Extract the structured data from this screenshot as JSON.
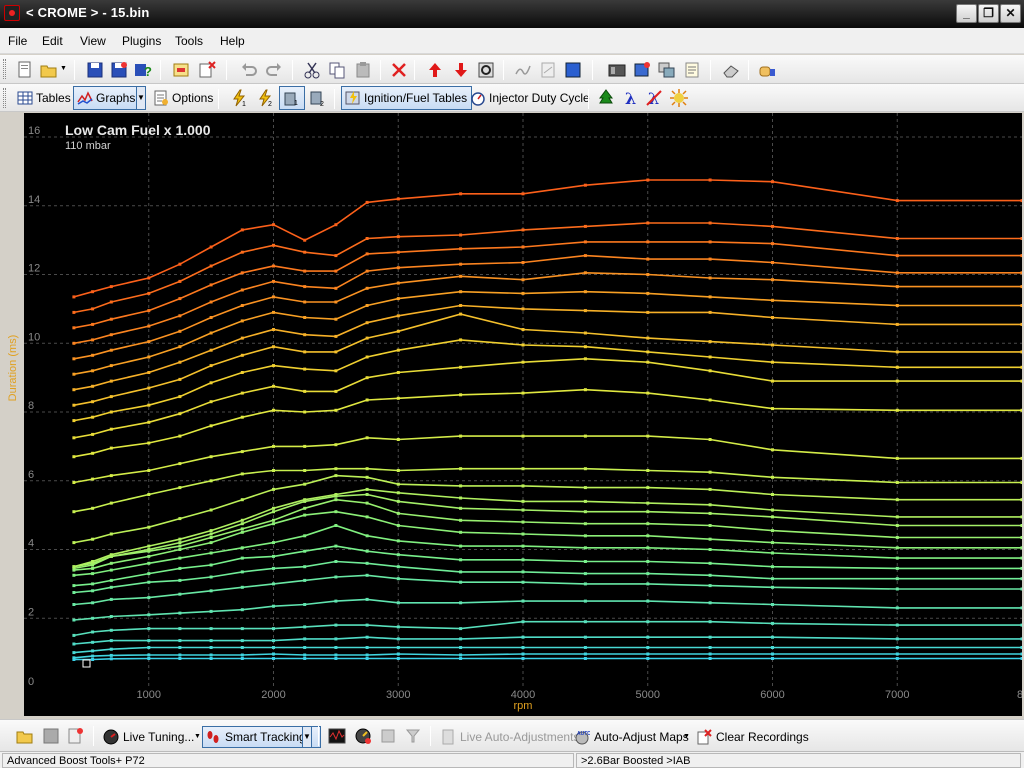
{
  "window": {
    "title": "< CROME > - 15.bin"
  },
  "menu": [
    "File",
    "Edit",
    "View",
    "Plugins",
    "Tools",
    "Help"
  ],
  "toolbar2": {
    "tables": "Tables",
    "graphs": "Graphs",
    "options": "Options",
    "ignition_fuel_tables": "Ignition/Fuel Tables",
    "injector_duty_cycle": "Injector Duty Cycle"
  },
  "graph": {
    "title": "Low Cam Fuel x 1.000",
    "subtitle": "110 mbar",
    "ylabel": "Duration (ms)",
    "xlabel": "rpm"
  },
  "chart_data": {
    "type": "line",
    "title": "Low Cam Fuel x 1.000",
    "subtitle": "110 mbar",
    "xlabel": "rpm",
    "ylabel": "Duration (ms)",
    "xlim": [
      0,
      8000
    ],
    "ylim": [
      0,
      16.7
    ],
    "x_ticks": [
      "1000",
      "2000",
      "3000",
      "4000",
      "5000",
      "6000",
      "7000",
      "8"
    ],
    "y_ticks": [
      "0",
      "2",
      "4",
      "6",
      "8",
      "10",
      "12",
      "14",
      "16"
    ],
    "grid": true,
    "x": [
      400,
      550,
      700,
      1000,
      1250,
      1500,
      1750,
      2000,
      2250,
      2500,
      2750,
      3000,
      3500,
      4000,
      4500,
      5000,
      5500,
      6000,
      7000,
      8000
    ],
    "series": [
      {
        "values": [
          0.8,
          0.8,
          0.82,
          0.83,
          0.83,
          0.83,
          0.83,
          0.83,
          0.83,
          0.83,
          0.83,
          0.83,
          0.83,
          0.83,
          0.83,
          0.83,
          0.83,
          0.83,
          0.83,
          0.83
        ],
        "color": "#3ad0e8"
      },
      {
        "values": [
          0.85,
          0.9,
          0.92,
          0.93,
          0.93,
          0.93,
          0.93,
          0.96,
          0.93,
          0.93,
          0.93,
          0.96,
          0.93,
          0.96,
          0.96,
          0.96,
          0.96,
          0.96,
          0.96,
          0.96
        ],
        "color": "#40d4e0"
      },
      {
        "values": [
          1.0,
          1.05,
          1.1,
          1.15,
          1.15,
          1.15,
          1.15,
          1.15,
          1.15,
          1.15,
          1.15,
          1.15,
          1.15,
          1.15,
          1.15,
          1.15,
          1.15,
          1.15,
          1.15,
          1.15
        ],
        "color": "#48d8d4"
      },
      {
        "values": [
          1.25,
          1.3,
          1.35,
          1.35,
          1.35,
          1.35,
          1.35,
          1.35,
          1.4,
          1.4,
          1.45,
          1.4,
          1.4,
          1.45,
          1.45,
          1.45,
          1.45,
          1.45,
          1.4,
          1.4
        ],
        "color": "#50dcc8"
      },
      {
        "values": [
          1.5,
          1.6,
          1.65,
          1.7,
          1.7,
          1.7,
          1.7,
          1.7,
          1.75,
          1.8,
          1.8,
          1.75,
          1.7,
          1.9,
          1.9,
          1.9,
          1.9,
          1.85,
          1.8,
          1.8
        ],
        "color": "#58e0bc"
      },
      {
        "values": [
          1.95,
          2.0,
          2.05,
          2.1,
          2.15,
          2.2,
          2.25,
          2.35,
          2.4,
          2.5,
          2.55,
          2.45,
          2.45,
          2.5,
          2.5,
          2.5,
          2.45,
          2.4,
          2.3,
          2.3
        ],
        "color": "#60e4b0"
      },
      {
        "values": [
          2.4,
          2.45,
          2.55,
          2.6,
          2.7,
          2.8,
          2.9,
          3.0,
          3.1,
          3.2,
          3.25,
          3.15,
          3.05,
          3.05,
          3.0,
          3.0,
          2.95,
          2.9,
          2.85,
          2.85
        ],
        "color": "#68e8a4"
      },
      {
        "values": [
          2.75,
          2.8,
          2.9,
          3.05,
          3.1,
          3.2,
          3.35,
          3.45,
          3.5,
          3.65,
          3.6,
          3.5,
          3.35,
          3.35,
          3.3,
          3.3,
          3.25,
          3.15,
          3.15,
          3.15
        ],
        "color": "#70ec98"
      },
      {
        "values": [
          2.95,
          3.0,
          3.1,
          3.3,
          3.45,
          3.55,
          3.75,
          3.8,
          3.95,
          4.1,
          3.95,
          3.85,
          3.7,
          3.7,
          3.65,
          3.65,
          3.6,
          3.5,
          3.45,
          3.45
        ],
        "color": "#78f08c"
      },
      {
        "values": [
          3.25,
          3.3,
          3.4,
          3.6,
          3.75,
          3.9,
          4.05,
          4.2,
          4.4,
          4.7,
          4.4,
          4.25,
          4.1,
          4.1,
          4.05,
          4.05,
          4.0,
          3.9,
          3.75,
          3.75
        ],
        "color": "#80f080"
      },
      {
        "values": [
          3.4,
          3.45,
          3.6,
          3.8,
          4.0,
          4.2,
          4.5,
          4.75,
          5.0,
          5.1,
          4.95,
          4.7,
          4.5,
          4.45,
          4.4,
          4.4,
          4.3,
          4.2,
          4.05,
          4.05
        ],
        "color": "#8cf078"
      },
      {
        "values": [
          3.45,
          3.55,
          3.8,
          3.95,
          4.1,
          4.35,
          4.6,
          4.85,
          5.2,
          5.45,
          5.35,
          5.05,
          4.85,
          4.8,
          4.75,
          4.75,
          4.7,
          4.55,
          4.35,
          4.35
        ],
        "color": "#98f070"
      },
      {
        "values": [
          3.5,
          3.6,
          3.8,
          4.0,
          4.2,
          4.45,
          4.75,
          5.1,
          5.4,
          5.55,
          5.6,
          5.4,
          5.2,
          5.15,
          5.1,
          5.1,
          5.05,
          4.95,
          4.7,
          4.7
        ],
        "color": "#a4f068"
      },
      {
        "values": [
          3.5,
          3.65,
          3.85,
          4.1,
          4.3,
          4.55,
          4.85,
          5.2,
          5.45,
          5.6,
          5.75,
          5.65,
          5.5,
          5.4,
          5.4,
          5.35,
          5.3,
          5.15,
          4.95,
          4.95
        ],
        "color": "#b0f060"
      },
      {
        "values": [
          4.2,
          4.3,
          4.45,
          4.65,
          4.9,
          5.15,
          5.45,
          5.75,
          5.9,
          6.15,
          6.1,
          5.9,
          5.85,
          5.85,
          5.8,
          5.8,
          5.75,
          5.6,
          5.45,
          5.45
        ],
        "color": "#bcf058"
      },
      {
        "values": [
          5.1,
          5.2,
          5.35,
          5.6,
          5.8,
          6.0,
          6.2,
          6.3,
          6.3,
          6.35,
          6.35,
          6.3,
          6.35,
          6.35,
          6.35,
          6.3,
          6.25,
          6.1,
          5.95,
          5.95
        ],
        "color": "#c8f050"
      },
      {
        "values": [
          5.95,
          6.05,
          6.15,
          6.3,
          6.5,
          6.7,
          6.85,
          7.0,
          7.0,
          7.05,
          7.25,
          7.2,
          7.3,
          7.3,
          7.3,
          7.3,
          7.2,
          6.9,
          6.65,
          6.65
        ],
        "color": "#d4ec48"
      },
      {
        "values": [
          6.7,
          6.8,
          6.95,
          7.1,
          7.3,
          7.6,
          7.85,
          8.05,
          8.0,
          8.05,
          8.35,
          8.4,
          8.5,
          8.55,
          8.65,
          8.55,
          8.35,
          8.1,
          8.05,
          8.05
        ],
        "color": "#e0e840"
      },
      {
        "values": [
          7.25,
          7.35,
          7.5,
          7.7,
          7.95,
          8.3,
          8.55,
          8.75,
          8.6,
          8.6,
          9.0,
          9.15,
          9.3,
          9.45,
          9.55,
          9.45,
          9.2,
          8.9,
          8.9,
          8.9
        ],
        "color": "#e8dc38"
      },
      {
        "values": [
          7.75,
          7.85,
          8.0,
          8.2,
          8.45,
          8.85,
          9.15,
          9.35,
          9.25,
          9.2,
          9.6,
          9.8,
          10.1,
          9.95,
          9.9,
          9.75,
          9.6,
          9.45,
          9.3,
          9.3
        ],
        "color": "#f0d030"
      },
      {
        "values": [
          8.2,
          8.3,
          8.45,
          8.7,
          8.95,
          9.35,
          9.65,
          9.9,
          9.75,
          9.75,
          10.15,
          10.35,
          10.85,
          10.4,
          10.3,
          10.15,
          10.05,
          9.95,
          9.75,
          9.75
        ],
        "color": "#f4c02c"
      },
      {
        "values": [
          8.65,
          8.75,
          8.9,
          9.15,
          9.45,
          9.8,
          10.15,
          10.4,
          10.25,
          10.2,
          10.6,
          10.8,
          11.1,
          11.0,
          10.95,
          10.9,
          10.9,
          10.75,
          10.55,
          10.55
        ],
        "color": "#f6b028"
      },
      {
        "values": [
          9.1,
          9.2,
          9.35,
          9.6,
          9.9,
          10.3,
          10.65,
          10.9,
          10.75,
          10.7,
          11.1,
          11.3,
          11.5,
          11.45,
          11.5,
          11.45,
          11.35,
          11.25,
          11.1,
          11.1
        ],
        "color": "#f8a024"
      },
      {
        "values": [
          9.55,
          9.65,
          9.8,
          10.05,
          10.35,
          10.75,
          11.1,
          11.35,
          11.2,
          11.2,
          11.6,
          11.75,
          11.95,
          11.85,
          12.05,
          12.0,
          11.9,
          11.85,
          11.65,
          11.65
        ],
        "color": "#fa9222"
      },
      {
        "values": [
          10.0,
          10.1,
          10.25,
          10.5,
          10.8,
          11.2,
          11.55,
          11.8,
          11.65,
          11.6,
          12.1,
          12.2,
          12.3,
          12.35,
          12.55,
          12.45,
          12.45,
          12.35,
          12.05,
          12.05
        ],
        "color": "#fb8420"
      },
      {
        "values": [
          10.45,
          10.55,
          10.7,
          10.95,
          11.3,
          11.7,
          12.05,
          12.25,
          12.1,
          12.1,
          12.6,
          12.65,
          12.75,
          12.8,
          12.95,
          12.95,
          12.95,
          12.9,
          12.55,
          12.55
        ],
        "color": "#fc781e"
      },
      {
        "values": [
          10.9,
          11.0,
          11.2,
          11.45,
          11.8,
          12.25,
          12.65,
          12.85,
          12.65,
          12.55,
          13.05,
          13.1,
          13.15,
          13.3,
          13.4,
          13.5,
          13.5,
          13.4,
          13.05,
          13.05
        ],
        "color": "#fc6c1c"
      },
      {
        "values": [
          11.35,
          11.5,
          11.65,
          11.9,
          12.3,
          12.8,
          13.3,
          13.45,
          13.0,
          13.45,
          14.1,
          14.2,
          14.35,
          14.35,
          14.6,
          14.75,
          14.75,
          14.7,
          14.15,
          14.15
        ],
        "color": "#fc601a"
      }
    ]
  },
  "bottombar": {
    "live_tuning": "Live Tuning...",
    "smart_tracking": "Smart Tracking",
    "live_auto_adjustments": "Live Auto-Adjustments",
    "auto_adjust_maps": "Auto-Adjust Maps",
    "clear_recordings": "Clear Recordings"
  },
  "status": {
    "left": "Advanced Boost Tools+ P72",
    "right": ">2.6Bar Boosted >IAB"
  }
}
